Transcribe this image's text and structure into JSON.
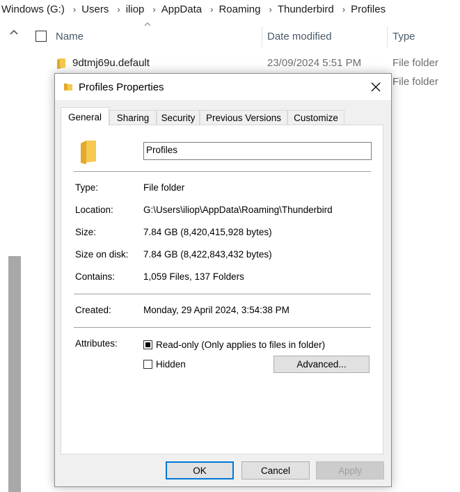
{
  "breadcrumb": [
    "Windows (G:)",
    "Users",
    "iliop",
    "AppData",
    "Roaming",
    "Thunderbird",
    "Profiles"
  ],
  "columns": {
    "name": "Name",
    "date": "Date modified",
    "type": "Type"
  },
  "rows": [
    {
      "name": "9dtmj69u.default",
      "date": "23/09/2024 5:51 PM",
      "type": "File folder"
    },
    {
      "name": "",
      "date": "",
      "type": "File folder"
    }
  ],
  "dialog": {
    "title": "Profiles Properties",
    "tabs": [
      "General",
      "Sharing",
      "Security",
      "Previous Versions",
      "Customize"
    ],
    "active_tab": "General",
    "folder_name": "Profiles",
    "type_label": "Type:",
    "type_value": "File folder",
    "location_label": "Location:",
    "location_value": "G:\\Users\\iliop\\AppData\\Roaming\\Thunderbird",
    "size_label": "Size:",
    "size_value": "7.84 GB (8,420,415,928 bytes)",
    "size_on_disk_label": "Size on disk:",
    "size_on_disk_value": "7.84 GB (8,422,843,432 bytes)",
    "contains_label": "Contains:",
    "contains_value": "1,059 Files, 137 Folders",
    "created_label": "Created:",
    "created_value": "Monday, 29 April 2024, 3:54:38 PM",
    "attributes_label": "Attributes:",
    "readonly_label": "Read-only (Only applies to files in folder)",
    "hidden_label": "Hidden",
    "advanced_label": "Advanced...",
    "ok_label": "OK",
    "cancel_label": "Cancel",
    "apply_label": "Apply"
  },
  "colors": {
    "folder": "#f6c850",
    "accent": "#0078d7"
  }
}
